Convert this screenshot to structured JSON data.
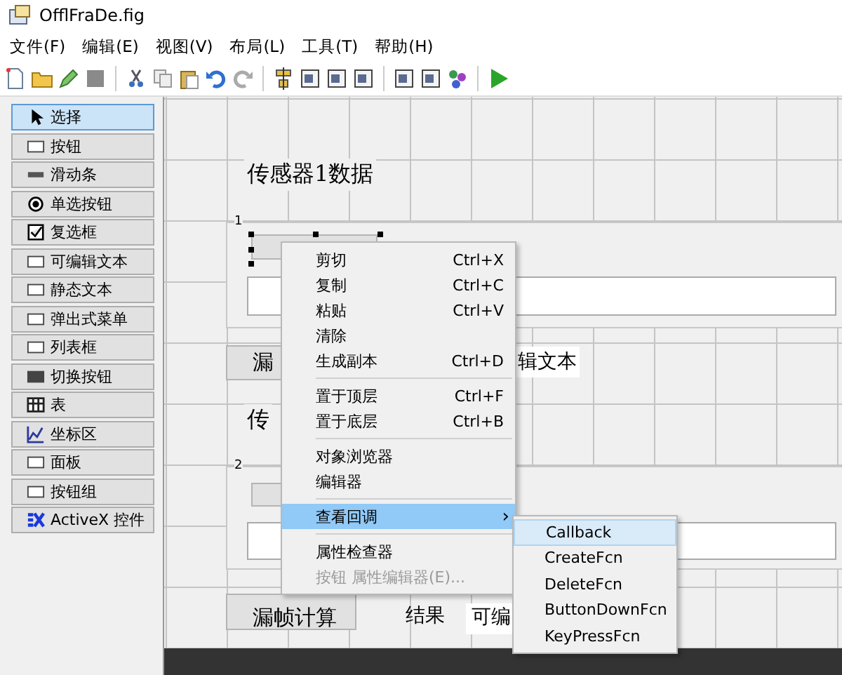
{
  "window": {
    "title": "OfflFraDe.fig"
  },
  "menu_bar": [
    "文件(F)",
    "编辑(E)",
    "视图(V)",
    "布局(L)",
    "工具(T)",
    "帮助(H)"
  ],
  "palette": [
    {
      "kind": "pointer",
      "label": "选择",
      "selected": true
    },
    {
      "kind": "pushbutton",
      "label": "按钮",
      "selected": false
    },
    {
      "kind": "slider",
      "label": "滑动条",
      "selected": false
    },
    {
      "kind": "radio",
      "label": "单选按钮",
      "selected": false
    },
    {
      "kind": "checkbox",
      "label": "复选框",
      "selected": false
    },
    {
      "kind": "edit",
      "label": "可编辑文本",
      "selected": false
    },
    {
      "kind": "text",
      "label": "静态文本",
      "selected": false
    },
    {
      "kind": "popup",
      "label": "弹出式菜单",
      "selected": false
    },
    {
      "kind": "listbox",
      "label": "列表框",
      "selected": false
    },
    {
      "kind": "toggle",
      "label": "切换按钮",
      "selected": false
    },
    {
      "kind": "table",
      "label": "表",
      "selected": false
    },
    {
      "kind": "axes",
      "label": "坐标区",
      "selected": false
    },
    {
      "kind": "panel",
      "label": "面板",
      "selected": false
    },
    {
      "kind": "buttongroup",
      "label": "按钮组",
      "selected": false
    },
    {
      "kind": "activex",
      "label": "ActiveX 控件",
      "selected": false
    }
  ],
  "canvas": {
    "section_1": {
      "title": "传感器1数据",
      "panel_label": "1"
    },
    "row_1": {
      "button": "漏",
      "edit_text": "辑文本"
    },
    "section_2": {
      "title": "传",
      "panel_label": "2"
    },
    "row_2": {
      "button": "漏帧计算",
      "label": "结果",
      "edit_text": "可编"
    }
  },
  "context_menu": [
    {
      "kind": "item",
      "label": "剪切",
      "shortcut": "Ctrl+X",
      "selected": false,
      "disabled": false
    },
    {
      "kind": "item",
      "label": "复制",
      "shortcut": "Ctrl+C",
      "selected": false,
      "disabled": false
    },
    {
      "kind": "item",
      "label": "粘贴",
      "shortcut": "Ctrl+V",
      "selected": false,
      "disabled": false
    },
    {
      "kind": "item",
      "label": "清除",
      "selected": false,
      "disabled": false
    },
    {
      "kind": "item",
      "label": "生成副本",
      "shortcut": "Ctrl+D",
      "selected": false,
      "disabled": false
    },
    {
      "kind": "separator"
    },
    {
      "kind": "item",
      "label": "置于顶层",
      "shortcut": "Ctrl+F",
      "selected": false,
      "disabled": false
    },
    {
      "kind": "item",
      "label": "置于底层",
      "shortcut": "Ctrl+B",
      "selected": false,
      "disabled": false
    },
    {
      "kind": "separator"
    },
    {
      "kind": "item",
      "label": "对象浏览器",
      "selected": false,
      "disabled": false
    },
    {
      "kind": "item",
      "label": "编辑器",
      "selected": false,
      "disabled": false
    },
    {
      "kind": "separator"
    },
    {
      "kind": "submenu",
      "label": "查看回调",
      "arrow": "›",
      "selected": true,
      "disabled": false
    },
    {
      "kind": "separator"
    },
    {
      "kind": "item",
      "label": "属性检查器",
      "selected": false,
      "disabled": false
    },
    {
      "kind": "item",
      "label": "按钮 属性编辑器(E)...",
      "selected": false,
      "disabled": true
    }
  ],
  "submenu": [
    {
      "label": "Callback",
      "selected": true
    },
    {
      "label": "CreateFcn",
      "selected": false
    },
    {
      "label": "DeleteFcn",
      "selected": false
    },
    {
      "label": "ButtonDownFcn",
      "selected": false
    },
    {
      "label": "KeyPressFcn",
      "selected": false
    }
  ]
}
